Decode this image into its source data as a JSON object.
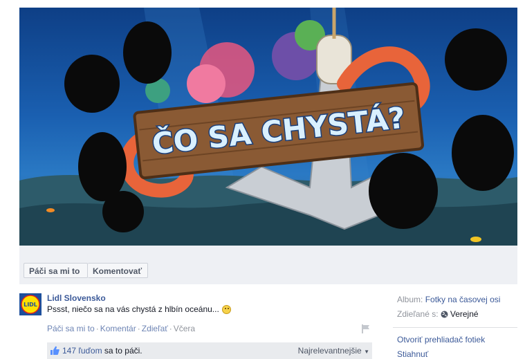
{
  "photo": {
    "sign_text": "ČO SA CHYSTÁ?"
  },
  "actions": {
    "like_label": "Páči sa mi to",
    "comment_label": "Komentovať"
  },
  "post": {
    "author": "Lidl Slovensko",
    "avatar_text": "LIDL",
    "text": "Pssst, niečo sa na vás chystá z hlbín oceánu...",
    "meta": {
      "like": "Páči sa mi to",
      "comment": "Komentár",
      "share": "Zdieľať",
      "time": "Včera"
    },
    "likes": {
      "count": "147 ľuďom",
      "rest": "sa to páči.",
      "sort": "Najrelevantnejšie"
    }
  },
  "sidebar": {
    "album_label": "Album:",
    "album_value": "Fotky na časovej osi",
    "shared_label": "Zdieľané s:",
    "shared_value": "Verejné",
    "open_viewer": "Otvoriť prehliadač fotiek",
    "download": "Stiahnuť"
  }
}
